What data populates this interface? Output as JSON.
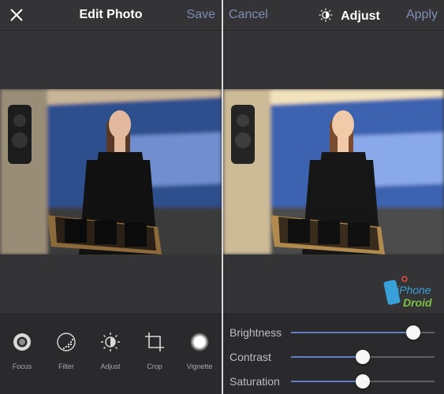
{
  "left_screen": {
    "title": "Edit Photo",
    "save_label": "Save",
    "tools": [
      {
        "label": "Focus",
        "icon": "focus-icon"
      },
      {
        "label": "Filter",
        "icon": "filter-icon"
      },
      {
        "label": "Adjust",
        "icon": "adjust-icon"
      },
      {
        "label": "Crop",
        "icon": "crop-icon"
      },
      {
        "label": "Vignette",
        "icon": "vignette-icon"
      }
    ]
  },
  "right_screen": {
    "title": "Adjust",
    "cancel_label": "Cancel",
    "apply_label": "Apply",
    "sliders": [
      {
        "label": "Brightness",
        "value": 0.85
      },
      {
        "label": "Contrast",
        "value": 0.5
      },
      {
        "label": "Saturation",
        "value": 0.5
      }
    ]
  },
  "watermark": {
    "brand": "iPhone Droid"
  },
  "colors": {
    "accent": "#7f8cb5",
    "slider_fill": "#5f7fc7",
    "background": "#343437"
  }
}
